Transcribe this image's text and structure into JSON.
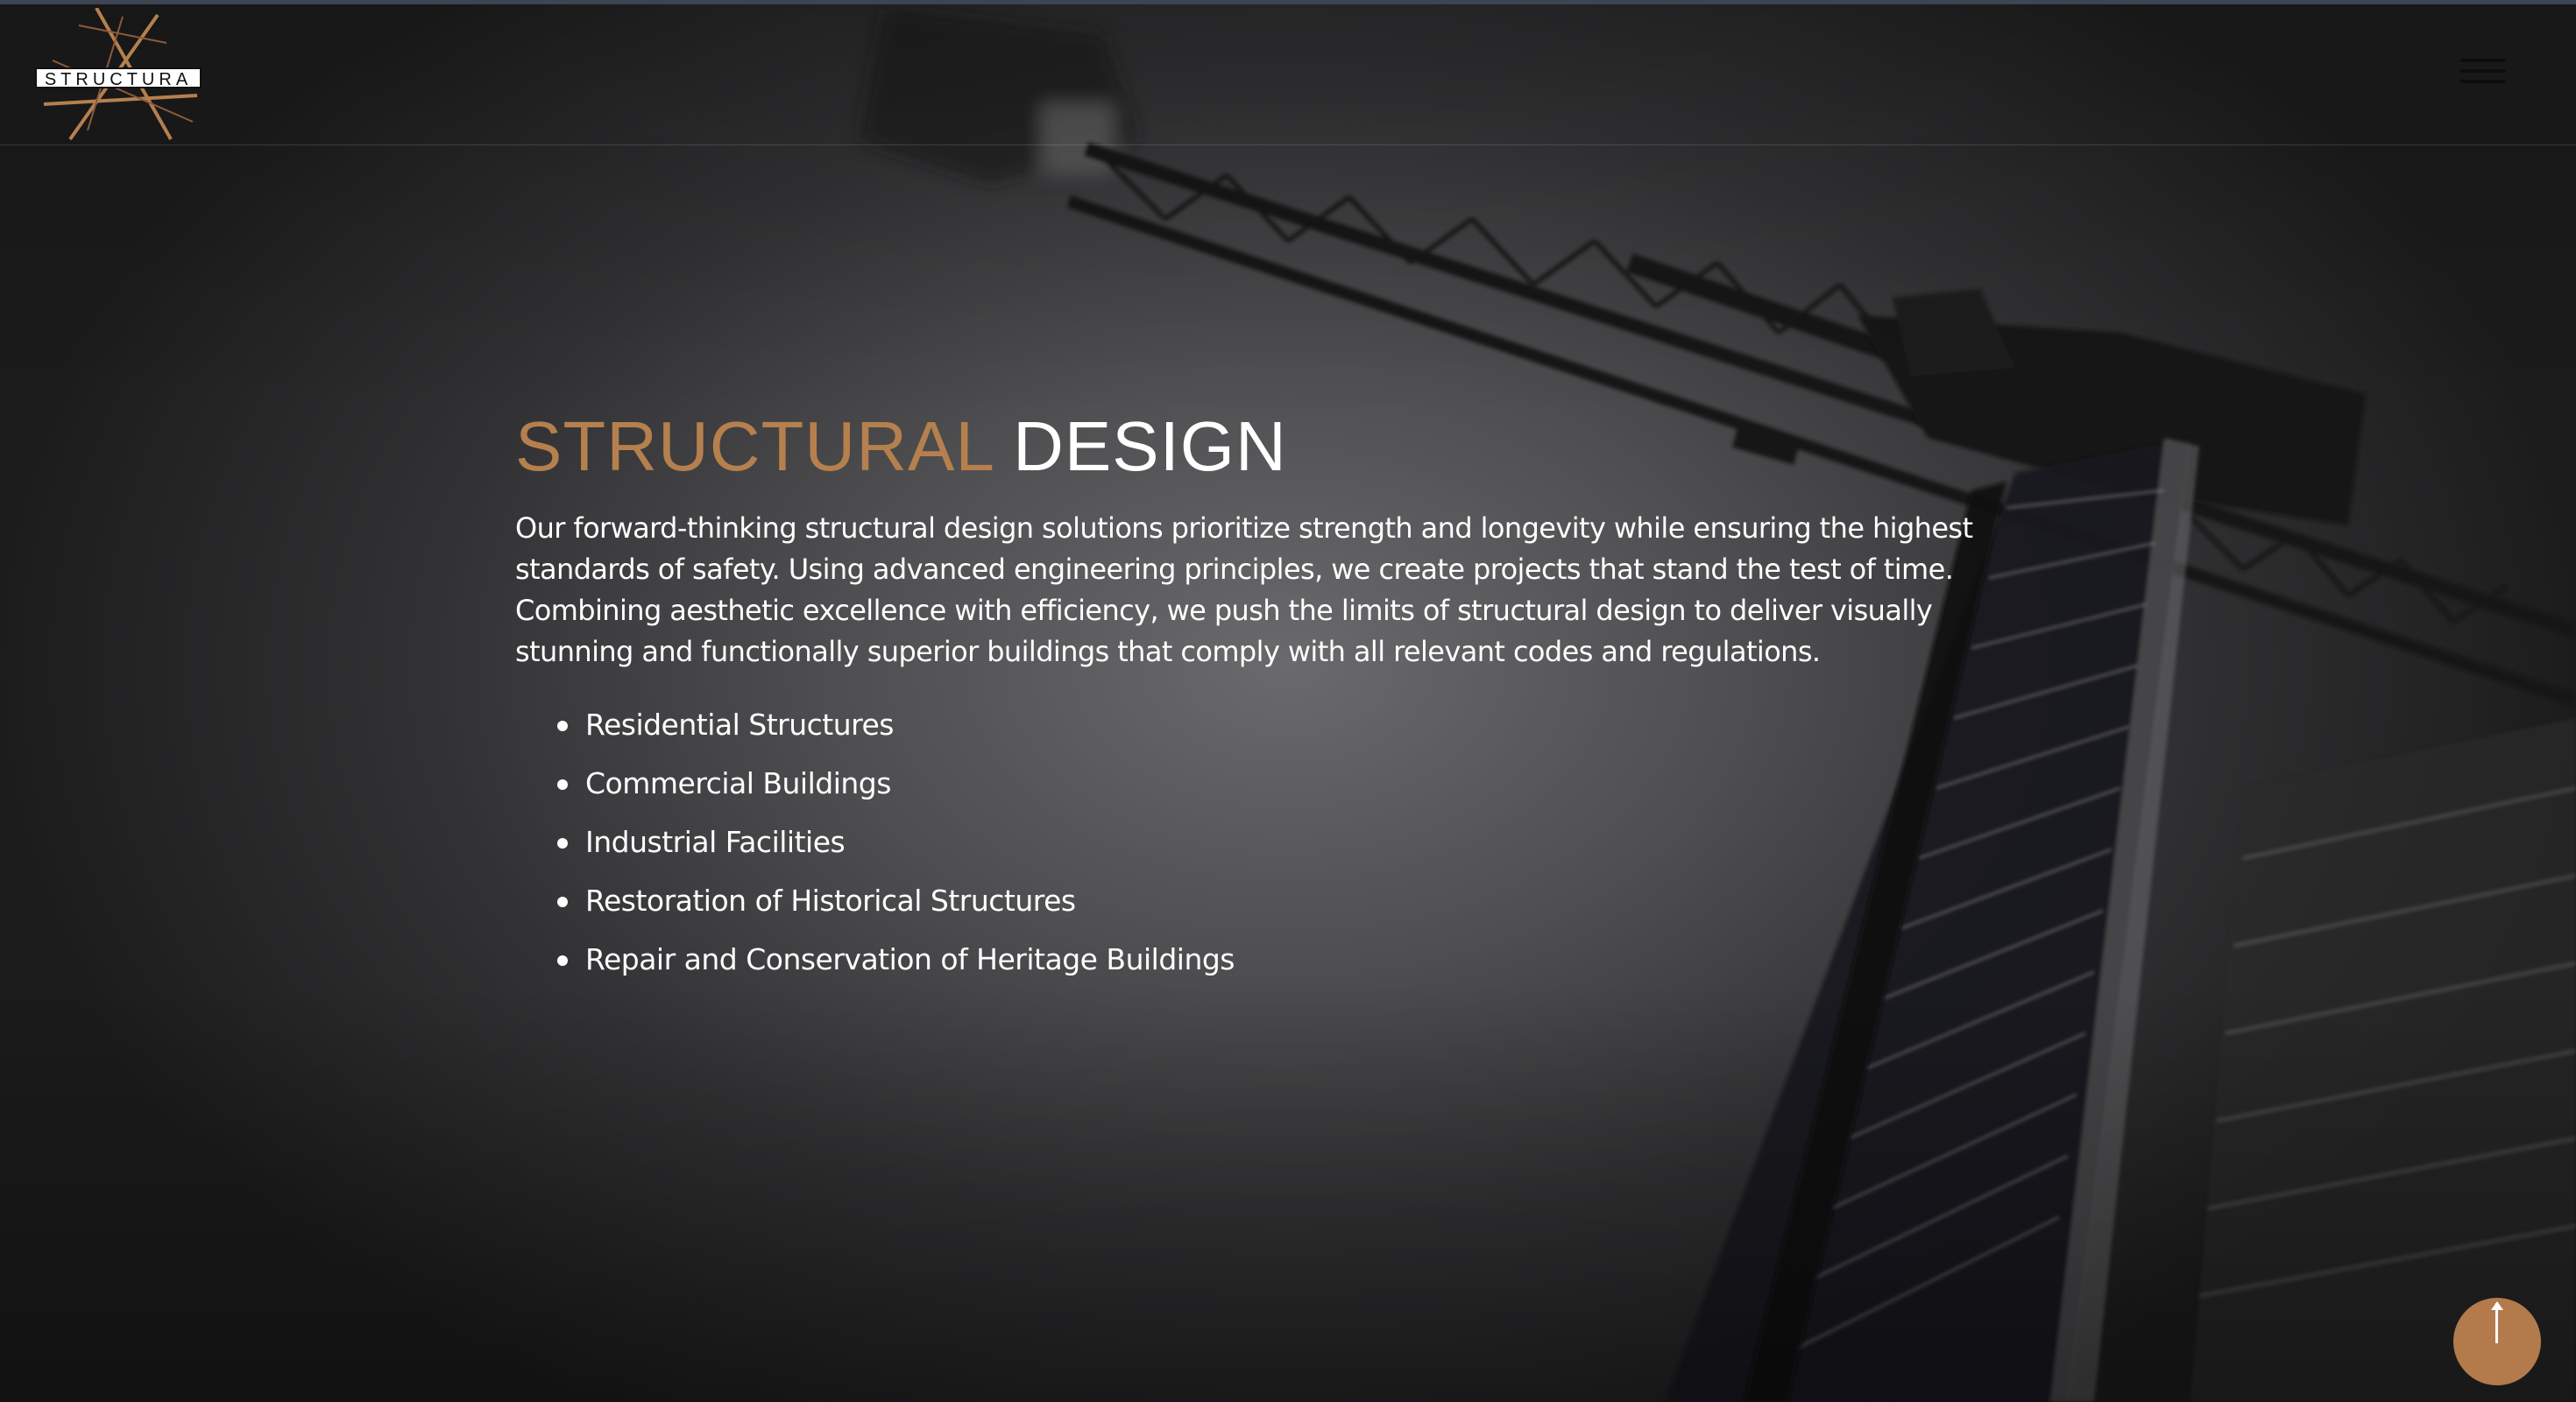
{
  "brand": {
    "logo_text": "STRUCTURA"
  },
  "header": {
    "menu_icon": "hamburger-menu-icon"
  },
  "section": {
    "title_accent": "STRUCTURAL",
    "title_rest": "DESIGN",
    "description": "Our forward-thinking structural design solutions prioritize strength and longevity while ensuring the highest standards of safety. Using advanced engineering principles, we create projects that stand the test of time. Combining aesthetic excellence with efficiency, we push the limits of structural design to deliver visually stunning and functionally superior buildings that comply with all relevant codes and regulations.",
    "services": [
      "Residential Structures",
      "Commercial Buildings",
      "Industrial Facilities",
      "Restoration of Historical Structures",
      "Repair and Conservation of Heritage Buildings"
    ]
  },
  "scroll_top": {
    "icon": "arrow-up-icon"
  },
  "colors": {
    "accent": "#b5804e",
    "text": "#ffffff",
    "background": "#1c1c1d"
  }
}
